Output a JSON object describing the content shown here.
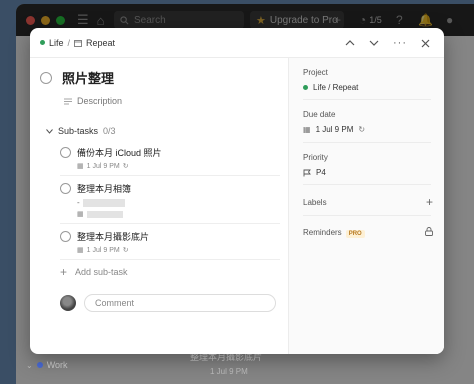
{
  "titlebar": {
    "search_placeholder": "Search",
    "upgrade_label": "Upgrade to Pro",
    "karma_label": "1/5"
  },
  "background": {
    "project_label": "Work",
    "task_title": "整理本月攝影底片",
    "task_date": "1 Jul 9 PM"
  },
  "modal": {
    "breadcrumb": {
      "project": "Life",
      "section": "Repeat"
    },
    "task": {
      "title": "照片整理",
      "description_placeholder": "Description"
    },
    "subtasks": {
      "header": "Sub-tasks",
      "count": "0/3",
      "items": [
        {
          "title": "備份本月 iCloud 照片",
          "date": "1 Jul 9 PM",
          "note": ""
        },
        {
          "title": "整理本月相簿",
          "date": "1 Jul 9 PM",
          "note": "-"
        },
        {
          "title": "整理本月攝影底片",
          "date": "1 Jul 9 PM",
          "note": ""
        }
      ],
      "add_label": "Add sub-task"
    },
    "comment": {
      "placeholder": "Comment"
    },
    "side": {
      "project_label": "Project",
      "project_value": "Life / Repeat",
      "due_label": "Due date",
      "due_value": "1 Jul 9 PM",
      "priority_label": "Priority",
      "priority_value": "P4",
      "labels_label": "Labels",
      "reminders_label": "Reminders",
      "pro_badge": "PRO"
    }
  },
  "colors": {
    "project_dot": "#2f9d5a",
    "work_dot": "#4a6bd6",
    "pro_text": "#b7791f"
  }
}
